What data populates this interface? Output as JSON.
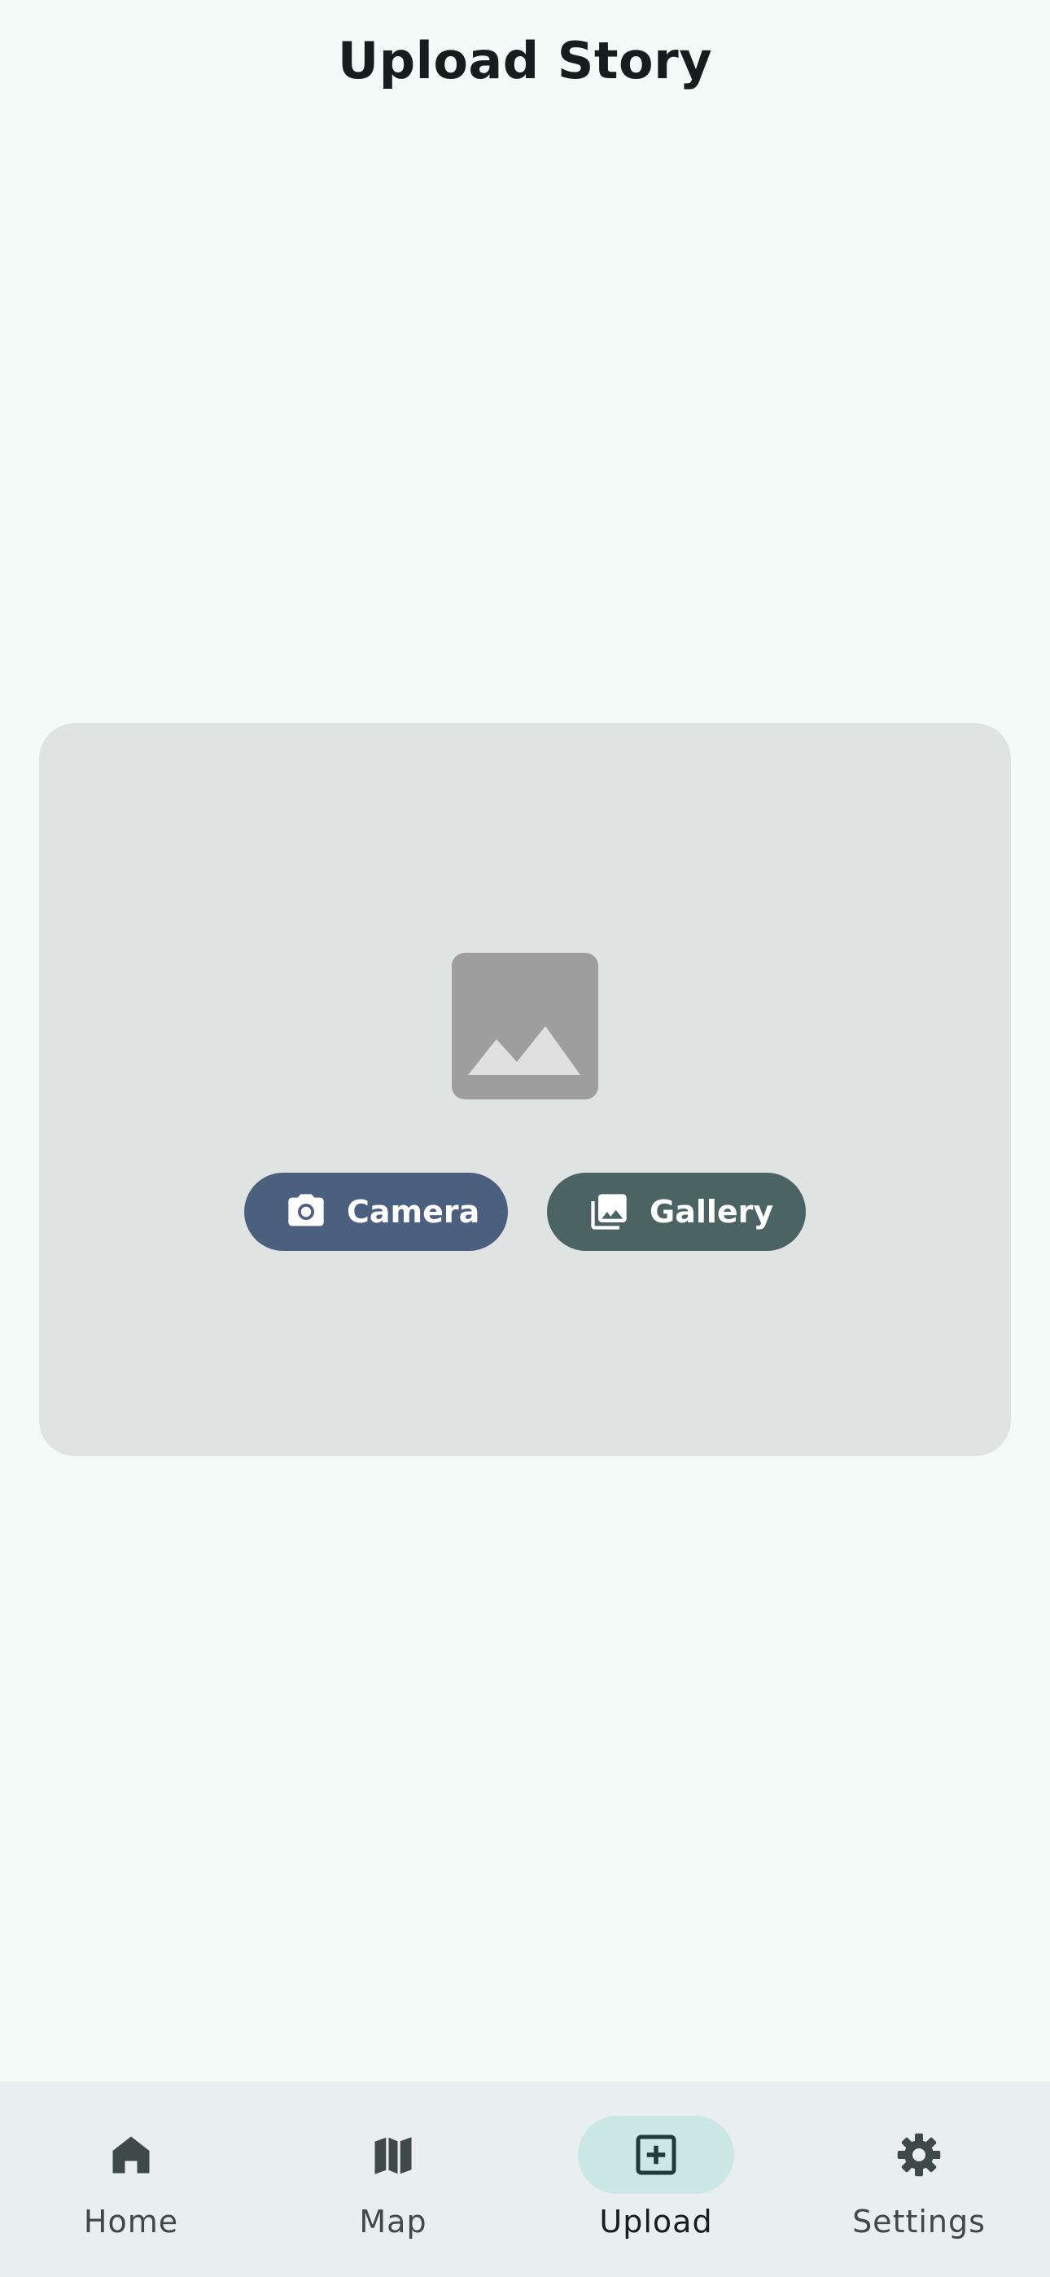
{
  "header": {
    "title": "Upload Story"
  },
  "upload_card": {
    "placeholder_icon": "image-placeholder-icon",
    "camera_button": {
      "label": "Camera",
      "icon": "camera-icon",
      "color": "#4b5f7f"
    },
    "gallery_button": {
      "label": "Gallery",
      "icon": "gallery-icon",
      "color": "#4b6463"
    }
  },
  "bottom_nav": {
    "items": [
      {
        "label": "Home",
        "icon": "home-icon",
        "active": false
      },
      {
        "label": "Map",
        "icon": "map-icon",
        "active": false
      },
      {
        "label": "Upload",
        "icon": "add-box-icon",
        "active": true
      },
      {
        "label": "Settings",
        "icon": "gear-icon",
        "active": false
      }
    ]
  },
  "colors": {
    "background": "#f4faf8",
    "card": "#dfe4e3",
    "nav_background": "#e9efee",
    "active_indicator": "#cce8e6"
  }
}
